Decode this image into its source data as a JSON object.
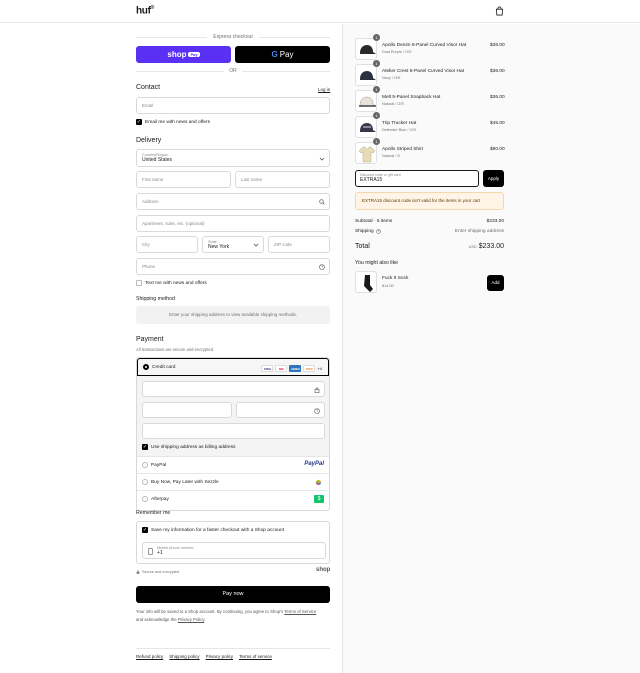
{
  "header": {
    "brand": "huf",
    "brand_mark": "®"
  },
  "express": {
    "label": "Express checkout",
    "shop_pay": "shop",
    "shop_pay_badge": "Pay",
    "gpay": "Pay",
    "gpay_g": "G",
    "or": "OR"
  },
  "contact": {
    "title": "Contact",
    "login": "Log in",
    "email_placeholder": "Email",
    "news_label": "Email me with news and offers"
  },
  "delivery": {
    "title": "Delivery",
    "country_label": "Country/Region",
    "country_value": "United States",
    "first_name": "First name",
    "last_name": "Last name",
    "address": "Address",
    "apartment": "Apartment, suite, etc. (optional)",
    "city": "City",
    "state_label": "State",
    "state_value": "New York",
    "zip": "ZIP code",
    "phone": "Phone",
    "text_label": "Text me with news and offers"
  },
  "shipping": {
    "title": "Shipping method",
    "placeholder": "Enter your shipping address to view available shipping methods."
  },
  "payment": {
    "title": "Payment",
    "subtitle": "All transactions are secure and encrypted.",
    "credit_card": "Credit card",
    "cards": [
      "VISA",
      "MC",
      "AMEX",
      "DISC",
      "+4"
    ],
    "billing_label": "Use shipping address as billing address",
    "paypal": "PayPal",
    "paypal_logo": "PayPal",
    "sezzle": "Buy Now, Pay Later with Sezzle",
    "afterpay": "Afterpay"
  },
  "remember": {
    "title": "Remember me",
    "save_label": "Save my information for a faster checkout with a Shop account",
    "phone_label": "Mobile phone number",
    "phone_value": "+1"
  },
  "secure": {
    "label": "Secure and encrypted",
    "shop": "shop"
  },
  "pay_now": "Pay now",
  "legal": {
    "line1": "Your info will be saved to a Shop account. By continuing, you agree to Shop's ",
    "terms": "Terms of Service",
    "line2": "and acknowledge the ",
    "privacy": "Privacy Policy",
    "period": "."
  },
  "footer": [
    "Refund policy",
    "Shipping policy",
    "Privacy policy",
    "Terms of service"
  ],
  "order": {
    "items": [
      {
        "name": "Apollo Denim 6-Panel Curved Visor Hat",
        "variant": "Dust Purple / O/S",
        "price": "$36.00",
        "qty": "1"
      },
      {
        "name": "Atelier Crest 6-Panel Curved Visor Hat",
        "variant": "Navy / O/S",
        "price": "$36.00",
        "qty": "1"
      },
      {
        "name": "Melt 5-Panel Snapback Hat",
        "variant": "Natural / O/S",
        "price": "$36.00",
        "qty": "1"
      },
      {
        "name": "Trip Trucker Hat",
        "variant": "Defender Blue / O/S",
        "price": "$45.00",
        "qty": "1"
      },
      {
        "name": "Apollo Striped Shirt",
        "variant": "Natural / S",
        "price": "$80.00",
        "qty": "1"
      }
    ],
    "discount_label": "Discount code or gift card",
    "discount_value": "EXTRA15",
    "apply": "Apply",
    "error": "EXTRA15 discount code isn't valid for the items in your cart",
    "subtotal_label": "Subtotal · 5 items",
    "subtotal_value": "$233.00",
    "shipping_label": "Shipping",
    "shipping_value": "Enter shipping address",
    "total_label": "Total",
    "currency": "USD",
    "total_value": "$233.00",
    "upsell_title": "You might also like",
    "upsell_name": "Fuck It Sock",
    "upsell_price": "$14.00",
    "add": "Add"
  }
}
